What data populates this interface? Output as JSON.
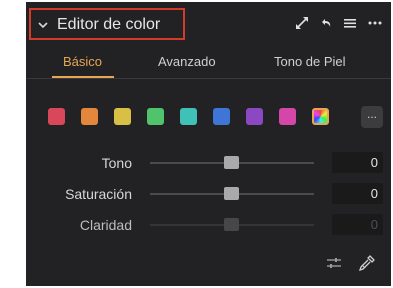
{
  "header": {
    "title": "Editor de color",
    "collapse_icon": "chevron-down-icon",
    "icons": [
      "expand-arrows-icon",
      "undo-icon",
      "menu-icon",
      "more-icon"
    ]
  },
  "tabs": [
    {
      "label": "Básico",
      "active": true
    },
    {
      "label": "Avanzado",
      "active": false
    },
    {
      "label": "Tono de Piel",
      "active": false
    }
  ],
  "swatches": {
    "colors": [
      "#d9485a",
      "#e2873c",
      "#d8c044",
      "#4fc46a",
      "#3fc1b8",
      "#3f75d6",
      "#8b48c2",
      "#d447a8"
    ],
    "all_colors_selected": true,
    "more_label": "..."
  },
  "controls": [
    {
      "label": "Tono",
      "value": "0",
      "enabled": true
    },
    {
      "label": "Saturación",
      "value": "0",
      "enabled": true
    },
    {
      "label": "Claridad",
      "value": "0",
      "enabled": false
    }
  ],
  "footer": {
    "icons": [
      "sliders-icon",
      "eyedropper-icon"
    ]
  },
  "colors": {
    "panel_bg": "#222224",
    "accent": "#e8a552",
    "highlight_border": "#d23a2a"
  }
}
